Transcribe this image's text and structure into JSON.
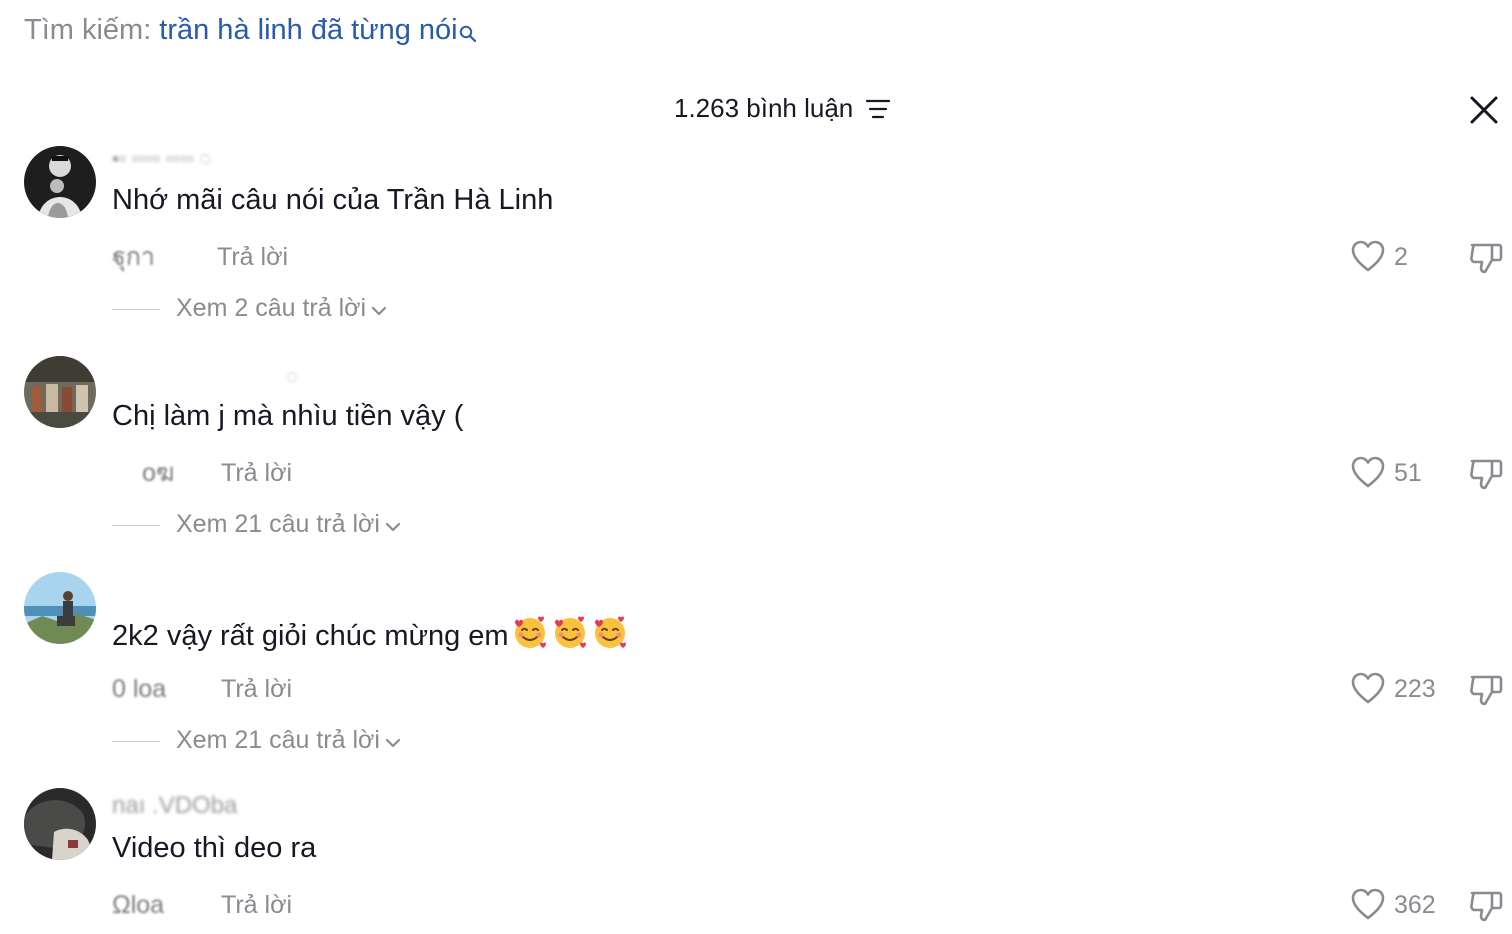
{
  "search": {
    "label": "Tìm kiếm:",
    "query": "trần hà linh đã từng nói",
    "icon": "search-icon"
  },
  "header": {
    "comment_count": "1.263 bình luận",
    "sort_icon": "sort-lines-icon",
    "close_icon": "close-icon"
  },
  "colors": {
    "query_blue": "#2a5ba8",
    "muted_gray": "#8a8b91",
    "text_dark": "#161823"
  },
  "comments": [
    {
      "username": "▪▫ ▫▫▫▫ ▫▫▫▫ ◌",
      "text": "Nhớ mãi câu nói của Trần Hà Linh",
      "date": "ฐุกา",
      "reply_label": "Trả lời",
      "likes": "2",
      "view_replies": "Xem 2 câu trả lời"
    },
    {
      "username": "◌",
      "text": "Chị làm j mà nhìu tiền vậy (",
      "date": "oฆ",
      "reply_label": "Trả lời",
      "likes": "51",
      "view_replies": "Xem 21 câu trả lời"
    },
    {
      "username": "",
      "text": "2k2 vậy rất giỏi chúc mừng em",
      "emojis": [
        "smiling-face-with-hearts",
        "smiling-face-with-hearts",
        "smiling-face-with-hearts"
      ],
      "date": "0 loa",
      "reply_label": "Trả lời",
      "likes": "223",
      "view_replies": "Xem 21 câu trả lời"
    },
    {
      "username": "naı .VDOba",
      "text": "Video thì deo ra",
      "date": "Ωloa",
      "reply_label": "Trả lời",
      "likes": "362"
    }
  ]
}
